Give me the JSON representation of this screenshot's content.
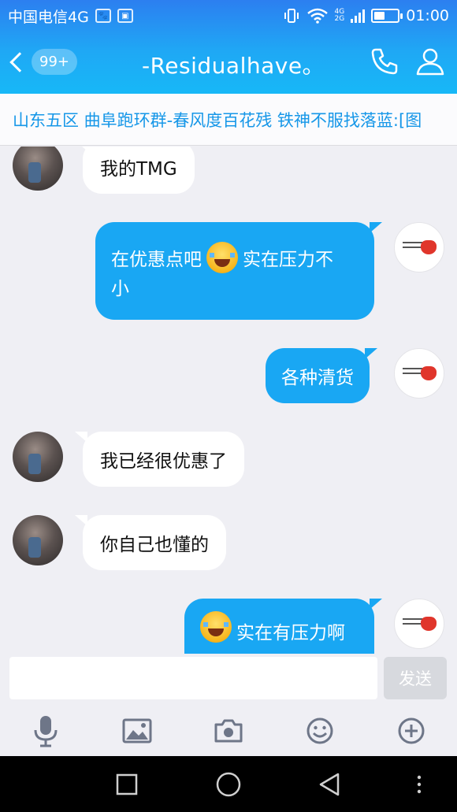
{
  "status_bar": {
    "carrier": "中国电信4G",
    "network_top": "4G",
    "network_bottom": "2G",
    "time": "01:00",
    "battery_level": 0.45
  },
  "header": {
    "unread_count": "99+",
    "title": "-Residualhave。"
  },
  "banner": {
    "text": "山东五区  曲阜跑环群-春风度百花残 铁神不服找落蓝:[图"
  },
  "messages": [
    {
      "side": "left",
      "text": "我的TMG"
    },
    {
      "side": "right",
      "text_before_emoji": "在优惠点吧",
      "text_after_emoji": " 实在压力不",
      "text_line2": "小"
    },
    {
      "side": "right",
      "text": "各种清货"
    },
    {
      "side": "left",
      "text": "我已经很优惠了"
    },
    {
      "side": "left",
      "text": "你自己也懂的"
    },
    {
      "side": "right",
      "text": "实在有压力啊"
    }
  ],
  "composer": {
    "placeholder": "",
    "send_label": "发送"
  },
  "toolbar": {
    "items": [
      "mic-icon",
      "image-icon",
      "camera-icon",
      "emoji-icon",
      "plus-icon"
    ]
  },
  "colors": {
    "accent": "#19a7f3",
    "banner_text": "#1697e8",
    "bg": "#efeff4"
  }
}
